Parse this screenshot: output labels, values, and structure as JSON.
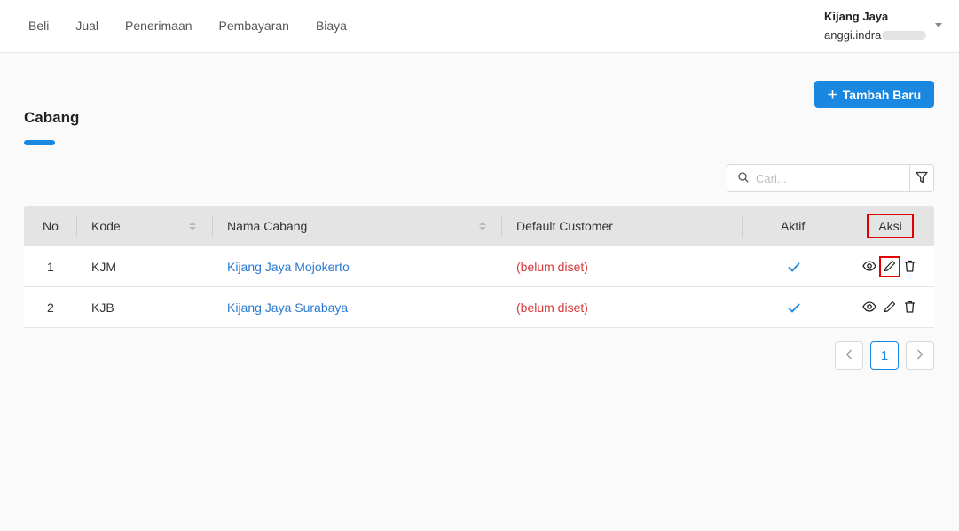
{
  "nav": {
    "items": [
      "Beli",
      "Jual",
      "Penerimaan",
      "Pembayaran",
      "Biaya"
    ]
  },
  "user": {
    "company": "Kijang Jaya",
    "email": "anggi.indra"
  },
  "actions": {
    "add_label": "Tambah Baru"
  },
  "page": {
    "title": "Cabang"
  },
  "search": {
    "placeholder": "Cari..."
  },
  "table": {
    "headers": {
      "no": "No",
      "kode": "Kode",
      "nama": "Nama Cabang",
      "customer": "Default Customer",
      "aktif": "Aktif",
      "aksi": "Aksi"
    },
    "rows": [
      {
        "no": "1",
        "kode": "KJM",
        "nama": "Kijang Jaya Mojokerto",
        "customer": "(belum diset)",
        "aktif": true
      },
      {
        "no": "2",
        "kode": "KJB",
        "nama": "Kijang Jaya Surabaya",
        "customer": "(belum diset)",
        "aktif": true
      }
    ]
  },
  "pagination": {
    "current": "1"
  },
  "colors": {
    "accent": "#1a87e0",
    "link": "#2b7ad3",
    "warning": "#d63b3b",
    "highlight": "#e00000"
  },
  "icons": [
    "search-icon",
    "filter-icon",
    "plus-icon",
    "check-icon",
    "eye-icon",
    "pencil-icon",
    "trash-icon",
    "chevron-left-icon",
    "chevron-right-icon",
    "caret-down-icon"
  ]
}
